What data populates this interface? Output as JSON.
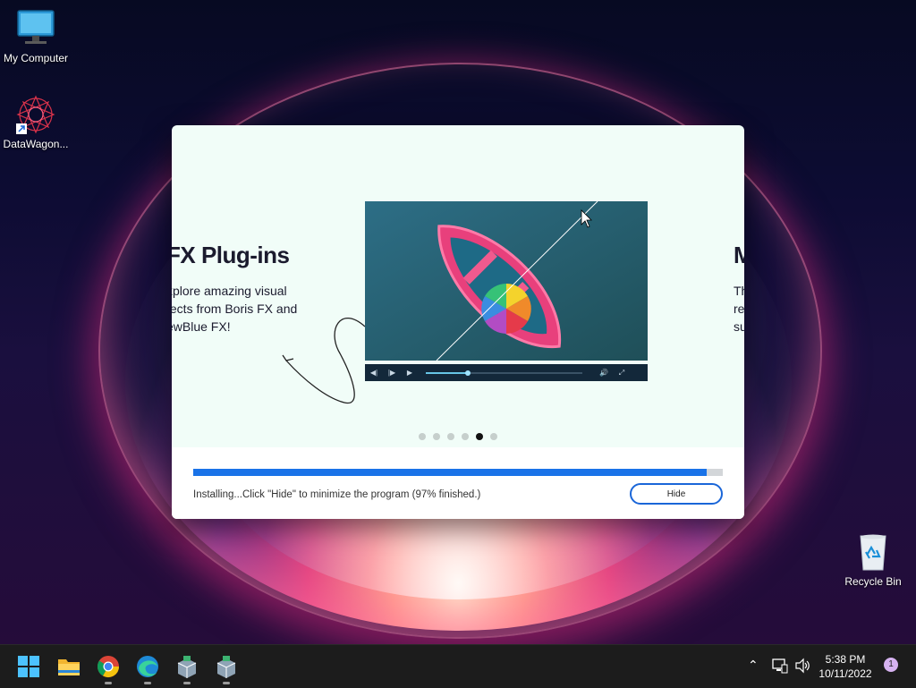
{
  "desktop": {
    "icons": [
      {
        "label": "My Computer",
        "icon": "monitor-icon"
      },
      {
        "label": "DataWagon...",
        "icon": "datawagon-app-icon"
      },
      {
        "label": "Recycle Bin",
        "icon": "recycle-bin-icon"
      }
    ]
  },
  "installer": {
    "slide": {
      "title": "FX Plug-ins",
      "text_lines": [
        "xplore amazing visual",
        "fects from Boris FX and",
        "ewBlue FX!"
      ],
      "next_title_fragment": "M",
      "next_text_fragments": [
        "Th",
        "re",
        "su"
      ]
    },
    "video_controls": {
      "progress": 0.27,
      "buttons": [
        "rewind-icon",
        "step-icon",
        "play-icon",
        "volume-icon",
        "fullscreen-icon"
      ]
    },
    "carousel": {
      "dot_count": 6,
      "active_index": 4
    },
    "progress_percent": 97,
    "status_text": "Installing...Click \"Hide\" to minimize the program (97% finished.)",
    "hide_label": "Hide"
  },
  "taskbar": {
    "pinned": [
      "start-icon",
      "file-explorer-icon",
      "chrome-icon",
      "edge-icon",
      "installer-app-icon",
      "installer-app-icon"
    ],
    "tray_icons": [
      "chevron-up-icon",
      "network-icon",
      "volume-icon"
    ],
    "time": "5:38 PM",
    "date": "10/11/2022",
    "notification_count": "1"
  },
  "colors": {
    "accent": "#1a73e8",
    "dialog_bg": "#f1fdf8",
    "taskbar_bg": "#1c1c1c"
  }
}
